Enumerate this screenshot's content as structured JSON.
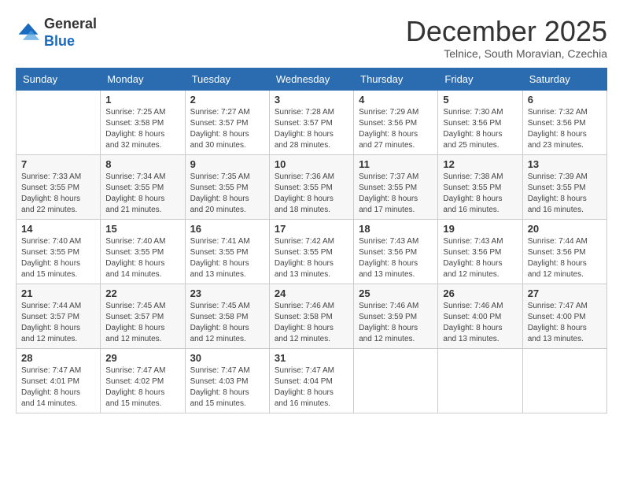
{
  "header": {
    "logo_general": "General",
    "logo_blue": "Blue",
    "month_title": "December 2025",
    "location": "Telnice, South Moravian, Czechia"
  },
  "weekdays": [
    "Sunday",
    "Monday",
    "Tuesday",
    "Wednesday",
    "Thursday",
    "Friday",
    "Saturday"
  ],
  "weeks": [
    [
      {
        "day": "",
        "sunrise": "",
        "sunset": "",
        "daylight": ""
      },
      {
        "day": "1",
        "sunrise": "Sunrise: 7:25 AM",
        "sunset": "Sunset: 3:58 PM",
        "daylight": "Daylight: 8 hours and 32 minutes."
      },
      {
        "day": "2",
        "sunrise": "Sunrise: 7:27 AM",
        "sunset": "Sunset: 3:57 PM",
        "daylight": "Daylight: 8 hours and 30 minutes."
      },
      {
        "day": "3",
        "sunrise": "Sunrise: 7:28 AM",
        "sunset": "Sunset: 3:57 PM",
        "daylight": "Daylight: 8 hours and 28 minutes."
      },
      {
        "day": "4",
        "sunrise": "Sunrise: 7:29 AM",
        "sunset": "Sunset: 3:56 PM",
        "daylight": "Daylight: 8 hours and 27 minutes."
      },
      {
        "day": "5",
        "sunrise": "Sunrise: 7:30 AM",
        "sunset": "Sunset: 3:56 PM",
        "daylight": "Daylight: 8 hours and 25 minutes."
      },
      {
        "day": "6",
        "sunrise": "Sunrise: 7:32 AM",
        "sunset": "Sunset: 3:56 PM",
        "daylight": "Daylight: 8 hours and 23 minutes."
      }
    ],
    [
      {
        "day": "7",
        "sunrise": "Sunrise: 7:33 AM",
        "sunset": "Sunset: 3:55 PM",
        "daylight": "Daylight: 8 hours and 22 minutes."
      },
      {
        "day": "8",
        "sunrise": "Sunrise: 7:34 AM",
        "sunset": "Sunset: 3:55 PM",
        "daylight": "Daylight: 8 hours and 21 minutes."
      },
      {
        "day": "9",
        "sunrise": "Sunrise: 7:35 AM",
        "sunset": "Sunset: 3:55 PM",
        "daylight": "Daylight: 8 hours and 20 minutes."
      },
      {
        "day": "10",
        "sunrise": "Sunrise: 7:36 AM",
        "sunset": "Sunset: 3:55 PM",
        "daylight": "Daylight: 8 hours and 18 minutes."
      },
      {
        "day": "11",
        "sunrise": "Sunrise: 7:37 AM",
        "sunset": "Sunset: 3:55 PM",
        "daylight": "Daylight: 8 hours and 17 minutes."
      },
      {
        "day": "12",
        "sunrise": "Sunrise: 7:38 AM",
        "sunset": "Sunset: 3:55 PM",
        "daylight": "Daylight: 8 hours and 16 minutes."
      },
      {
        "day": "13",
        "sunrise": "Sunrise: 7:39 AM",
        "sunset": "Sunset: 3:55 PM",
        "daylight": "Daylight: 8 hours and 16 minutes."
      }
    ],
    [
      {
        "day": "14",
        "sunrise": "Sunrise: 7:40 AM",
        "sunset": "Sunset: 3:55 PM",
        "daylight": "Daylight: 8 hours and 15 minutes."
      },
      {
        "day": "15",
        "sunrise": "Sunrise: 7:40 AM",
        "sunset": "Sunset: 3:55 PM",
        "daylight": "Daylight: 8 hours and 14 minutes."
      },
      {
        "day": "16",
        "sunrise": "Sunrise: 7:41 AM",
        "sunset": "Sunset: 3:55 PM",
        "daylight": "Daylight: 8 hours and 13 minutes."
      },
      {
        "day": "17",
        "sunrise": "Sunrise: 7:42 AM",
        "sunset": "Sunset: 3:55 PM",
        "daylight": "Daylight: 8 hours and 13 minutes."
      },
      {
        "day": "18",
        "sunrise": "Sunrise: 7:43 AM",
        "sunset": "Sunset: 3:56 PM",
        "daylight": "Daylight: 8 hours and 13 minutes."
      },
      {
        "day": "19",
        "sunrise": "Sunrise: 7:43 AM",
        "sunset": "Sunset: 3:56 PM",
        "daylight": "Daylight: 8 hours and 12 minutes."
      },
      {
        "day": "20",
        "sunrise": "Sunrise: 7:44 AM",
        "sunset": "Sunset: 3:56 PM",
        "daylight": "Daylight: 8 hours and 12 minutes."
      }
    ],
    [
      {
        "day": "21",
        "sunrise": "Sunrise: 7:44 AM",
        "sunset": "Sunset: 3:57 PM",
        "daylight": "Daylight: 8 hours and 12 minutes."
      },
      {
        "day": "22",
        "sunrise": "Sunrise: 7:45 AM",
        "sunset": "Sunset: 3:57 PM",
        "daylight": "Daylight: 8 hours and 12 minutes."
      },
      {
        "day": "23",
        "sunrise": "Sunrise: 7:45 AM",
        "sunset": "Sunset: 3:58 PM",
        "daylight": "Daylight: 8 hours and 12 minutes."
      },
      {
        "day": "24",
        "sunrise": "Sunrise: 7:46 AM",
        "sunset": "Sunset: 3:58 PM",
        "daylight": "Daylight: 8 hours and 12 minutes."
      },
      {
        "day": "25",
        "sunrise": "Sunrise: 7:46 AM",
        "sunset": "Sunset: 3:59 PM",
        "daylight": "Daylight: 8 hours and 12 minutes."
      },
      {
        "day": "26",
        "sunrise": "Sunrise: 7:46 AM",
        "sunset": "Sunset: 4:00 PM",
        "daylight": "Daylight: 8 hours and 13 minutes."
      },
      {
        "day": "27",
        "sunrise": "Sunrise: 7:47 AM",
        "sunset": "Sunset: 4:00 PM",
        "daylight": "Daylight: 8 hours and 13 minutes."
      }
    ],
    [
      {
        "day": "28",
        "sunrise": "Sunrise: 7:47 AM",
        "sunset": "Sunset: 4:01 PM",
        "daylight": "Daylight: 8 hours and 14 minutes."
      },
      {
        "day": "29",
        "sunrise": "Sunrise: 7:47 AM",
        "sunset": "Sunset: 4:02 PM",
        "daylight": "Daylight: 8 hours and 15 minutes."
      },
      {
        "day": "30",
        "sunrise": "Sunrise: 7:47 AM",
        "sunset": "Sunset: 4:03 PM",
        "daylight": "Daylight: 8 hours and 15 minutes."
      },
      {
        "day": "31",
        "sunrise": "Sunrise: 7:47 AM",
        "sunset": "Sunset: 4:04 PM",
        "daylight": "Daylight: 8 hours and 16 minutes."
      },
      {
        "day": "",
        "sunrise": "",
        "sunset": "",
        "daylight": ""
      },
      {
        "day": "",
        "sunrise": "",
        "sunset": "",
        "daylight": ""
      },
      {
        "day": "",
        "sunrise": "",
        "sunset": "",
        "daylight": ""
      }
    ]
  ]
}
